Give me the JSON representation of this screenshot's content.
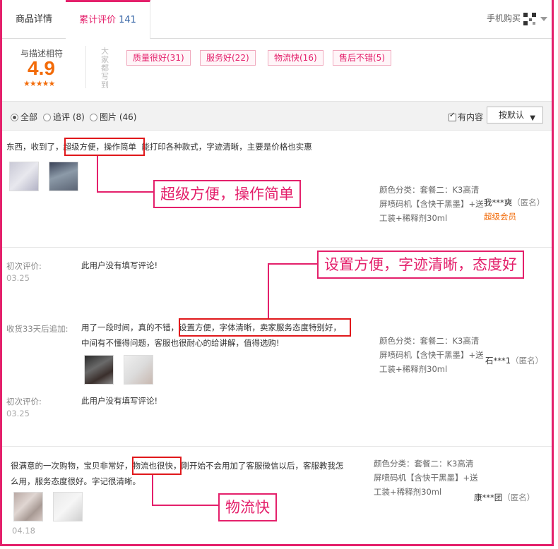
{
  "tabs": {
    "details": "商品详情",
    "reviews": "累计评价",
    "reviews_count": "141",
    "mobile_buy": "手机购买"
  },
  "summary": {
    "desc_label": "与描述相符",
    "score": "4.9",
    "stars": "★★★★★",
    "vertical_label": "大家都写到",
    "tags": [
      "质量很好(31)",
      "服务好(22)",
      "物流快(16)",
      "售后不错(5)"
    ]
  },
  "filter": {
    "all": "全部",
    "followup": "追评 (8)",
    "pictures": "图片 (46)",
    "has_content": "有内容",
    "sort": "按默认"
  },
  "reviews": [
    {
      "text_prefix": "东西，收到了，",
      "text_highlight": "超级方便，操作简单",
      "text_suffix": "能打印各种款式，字迹清晰，主要是价格也实惠",
      "sku": "颜色分类：套餐二：K3高清屏喷码机【含快干黑墨】+送工装+稀释剂30ml",
      "nick": "我***爽",
      "anon": "（匿名）",
      "vip": "超级会员",
      "callout": "超级方便，操作简单"
    },
    {
      "initial_label": "初次评价:",
      "initial_text": "此用户没有填写评论!",
      "initial_date": "03.25",
      "followup_label": "收货33天后追加:",
      "followup_prefix": "用了一段时间，真的不错，",
      "followup_highlight": "设置方便，字体清晰，卖家服务态度特别好，",
      "followup_line2": "中间有不懂得问题，客服也很耐心的给讲解，值得选购!",
      "initial_label_2": "初次评价:",
      "initial_text_2": "此用户没有填写评论!",
      "initial_date_2": "03.25",
      "sku": "颜色分类：套餐二：K3高清屏喷码机【含快干黑墨】+送工装+稀释剂30ml",
      "nick": "石***1",
      "anon": "（匿名）",
      "callout": "设置方便，字迹清晰，态度好"
    },
    {
      "text_prefix": "很满意的一次购物，宝贝非常好，",
      "text_highlight": "物流也很快，",
      "text_suffix": "刚开始不会用加了客服微信以后，客服教我怎",
      "text_line2": "么用，服务态度很好。字记很清晰。",
      "date": "04.18",
      "sku": "颜色分类：套餐二：K3高清屏喷码机【含快干黑墨】+送工装+稀释剂30ml",
      "nick": "康***团",
      "anon": "（匿名）",
      "callout": "物流快"
    }
  ]
}
